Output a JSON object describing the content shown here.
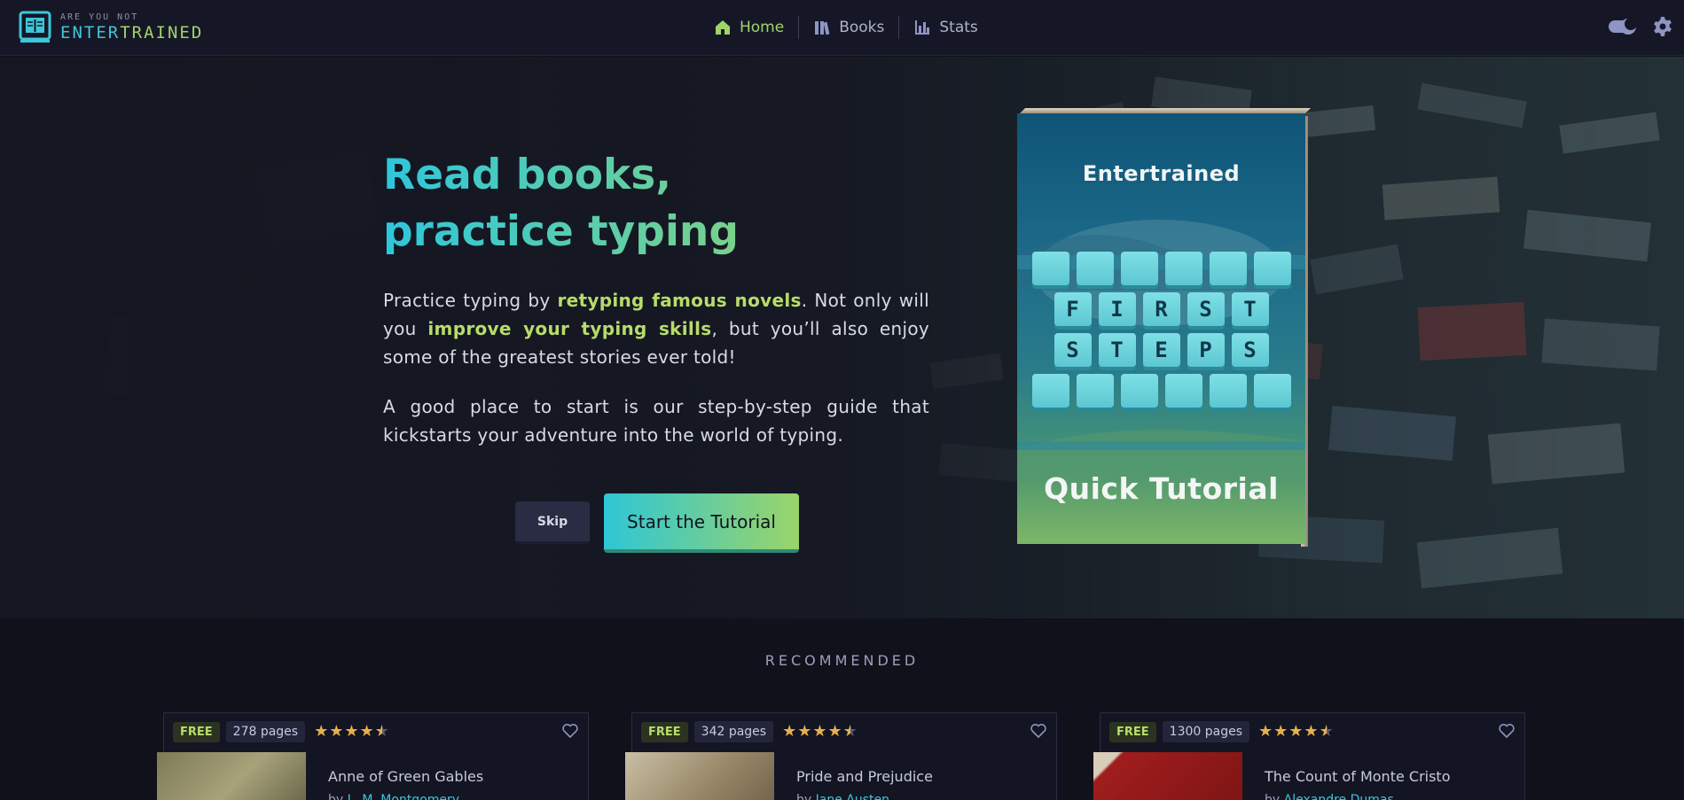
{
  "brand": {
    "small": "ARE YOU NOT",
    "big_part1": "ENTER",
    "big_part2": "TRAINED"
  },
  "nav": {
    "items": [
      {
        "label": "Home",
        "icon": "home-icon",
        "active": true
      },
      {
        "label": "Books",
        "icon": "books-icon",
        "active": false
      },
      {
        "label": "Stats",
        "icon": "stats-icon",
        "active": false
      }
    ]
  },
  "header_controls": {
    "theme_toggle_icon": "moon-toggle-icon",
    "settings_icon": "gear-icon"
  },
  "hero": {
    "title_line1": "Read books,",
    "title_line2": "practice typing",
    "p1_a": "Practice typing by ",
    "p1_hl1": "retyping famous novels",
    "p1_b": ". Not only will you ",
    "p1_hl2": "improve your typing skills",
    "p1_c": ", but you’ll also enjoy some of the greatest stories ever told!",
    "p2": "A good place to start is our step-by-step guide that kickstarts your adventure into the world of typing.",
    "skip_label": "Skip",
    "start_label": "Start the Tutorial"
  },
  "tutorial_book": {
    "brand": "Entertrained",
    "row1": [
      "F",
      "I",
      "R",
      "S",
      "T"
    ],
    "row2": [
      "S",
      "T",
      "E",
      "P",
      "S"
    ],
    "title": "Quick Tutorial"
  },
  "recommended": {
    "heading": "RECOMMENDED",
    "books": [
      {
        "badge": "FREE",
        "pages": "278 pages",
        "rating": 4.5,
        "title": "Anne of Green Gables",
        "by": "by ",
        "author": "L. M. Montgomery",
        "cover_color": "#8a8a66"
      },
      {
        "badge": "FREE",
        "pages": "342 pages",
        "rating": 4.5,
        "title": "Pride and Prejudice",
        "by": "by ",
        "author": "Jane Austen",
        "cover_color": "#a89776"
      },
      {
        "badge": "FREE",
        "pages": "1300 pages",
        "rating": 4.5,
        "title": "The Count of Monte Cristo",
        "by": "by ",
        "author": "Alexandre Dumas",
        "cover_color": "#a01d1d"
      }
    ]
  },
  "colors": {
    "accent_cyan": "#2ec6dc",
    "accent_green": "#9fd46a",
    "background": "#10111a"
  }
}
